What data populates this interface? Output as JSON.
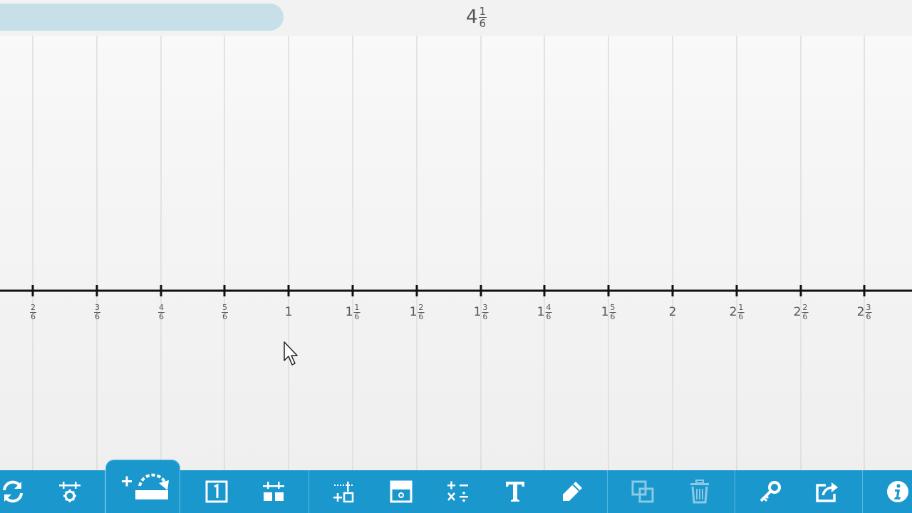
{
  "header": {
    "whole": "4",
    "numerator": "1",
    "denominator": "6"
  },
  "number_line": {
    "denominator": 6,
    "labels": [
      {
        "whole": "",
        "num": "2",
        "den": "6"
      },
      {
        "whole": "",
        "num": "3",
        "den": "6"
      },
      {
        "whole": "",
        "num": "4",
        "den": "6"
      },
      {
        "whole": "",
        "num": "5",
        "den": "6"
      },
      {
        "whole": "1",
        "num": "",
        "den": ""
      },
      {
        "whole": "1",
        "num": "1",
        "den": "6"
      },
      {
        "whole": "1",
        "num": "2",
        "den": "6"
      },
      {
        "whole": "1",
        "num": "3",
        "den": "6"
      },
      {
        "whole": "1",
        "num": "4",
        "den": "6"
      },
      {
        "whole": "1",
        "num": "5",
        "den": "6"
      },
      {
        "whole": "2",
        "num": "",
        "den": ""
      },
      {
        "whole": "2",
        "num": "1",
        "den": "6"
      },
      {
        "whole": "2",
        "num": "2",
        "den": "6"
      },
      {
        "whole": "2",
        "num": "3",
        "den": "6"
      }
    ]
  },
  "toolbar": {
    "background": "#1a97cc",
    "buttons": [
      {
        "name": "reset-icon"
      },
      {
        "name": "settings-icon"
      },
      {
        "name": "add-jump-icon"
      },
      {
        "name": "number-card-icon"
      },
      {
        "name": "grid-blocks-icon"
      },
      {
        "name": "add-point-icon"
      },
      {
        "name": "cover-icon"
      },
      {
        "name": "operations-icon"
      },
      {
        "name": "text-icon"
      },
      {
        "name": "pen-icon"
      },
      {
        "name": "duplicate-icon"
      },
      {
        "name": "trash-icon"
      },
      {
        "name": "key-icon"
      },
      {
        "name": "share-icon"
      },
      {
        "name": "info-icon"
      }
    ]
  }
}
